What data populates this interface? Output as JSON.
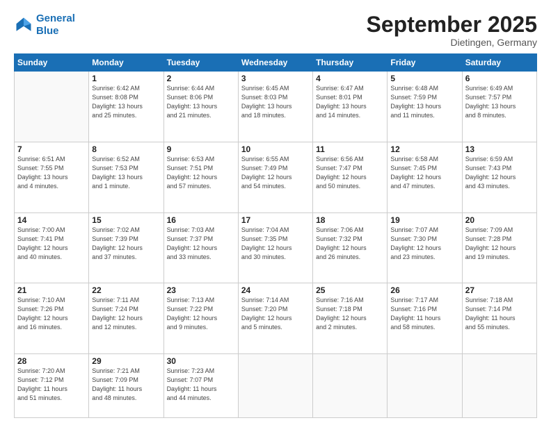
{
  "logo": {
    "line1": "General",
    "line2": "Blue"
  },
  "header": {
    "month": "September 2025",
    "location": "Dietingen, Germany"
  },
  "weekdays": [
    "Sunday",
    "Monday",
    "Tuesday",
    "Wednesday",
    "Thursday",
    "Friday",
    "Saturday"
  ],
  "weeks": [
    [
      {
        "day": "",
        "info": ""
      },
      {
        "day": "1",
        "info": "Sunrise: 6:42 AM\nSunset: 8:08 PM\nDaylight: 13 hours\nand 25 minutes."
      },
      {
        "day": "2",
        "info": "Sunrise: 6:44 AM\nSunset: 8:06 PM\nDaylight: 13 hours\nand 21 minutes."
      },
      {
        "day": "3",
        "info": "Sunrise: 6:45 AM\nSunset: 8:03 PM\nDaylight: 13 hours\nand 18 minutes."
      },
      {
        "day": "4",
        "info": "Sunrise: 6:47 AM\nSunset: 8:01 PM\nDaylight: 13 hours\nand 14 minutes."
      },
      {
        "day": "5",
        "info": "Sunrise: 6:48 AM\nSunset: 7:59 PM\nDaylight: 13 hours\nand 11 minutes."
      },
      {
        "day": "6",
        "info": "Sunrise: 6:49 AM\nSunset: 7:57 PM\nDaylight: 13 hours\nand 8 minutes."
      }
    ],
    [
      {
        "day": "7",
        "info": "Sunrise: 6:51 AM\nSunset: 7:55 PM\nDaylight: 13 hours\nand 4 minutes."
      },
      {
        "day": "8",
        "info": "Sunrise: 6:52 AM\nSunset: 7:53 PM\nDaylight: 13 hours\nand 1 minute."
      },
      {
        "day": "9",
        "info": "Sunrise: 6:53 AM\nSunset: 7:51 PM\nDaylight: 12 hours\nand 57 minutes."
      },
      {
        "day": "10",
        "info": "Sunrise: 6:55 AM\nSunset: 7:49 PM\nDaylight: 12 hours\nand 54 minutes."
      },
      {
        "day": "11",
        "info": "Sunrise: 6:56 AM\nSunset: 7:47 PM\nDaylight: 12 hours\nand 50 minutes."
      },
      {
        "day": "12",
        "info": "Sunrise: 6:58 AM\nSunset: 7:45 PM\nDaylight: 12 hours\nand 47 minutes."
      },
      {
        "day": "13",
        "info": "Sunrise: 6:59 AM\nSunset: 7:43 PM\nDaylight: 12 hours\nand 43 minutes."
      }
    ],
    [
      {
        "day": "14",
        "info": "Sunrise: 7:00 AM\nSunset: 7:41 PM\nDaylight: 12 hours\nand 40 minutes."
      },
      {
        "day": "15",
        "info": "Sunrise: 7:02 AM\nSunset: 7:39 PM\nDaylight: 12 hours\nand 37 minutes."
      },
      {
        "day": "16",
        "info": "Sunrise: 7:03 AM\nSunset: 7:37 PM\nDaylight: 12 hours\nand 33 minutes."
      },
      {
        "day": "17",
        "info": "Sunrise: 7:04 AM\nSunset: 7:35 PM\nDaylight: 12 hours\nand 30 minutes."
      },
      {
        "day": "18",
        "info": "Sunrise: 7:06 AM\nSunset: 7:32 PM\nDaylight: 12 hours\nand 26 minutes."
      },
      {
        "day": "19",
        "info": "Sunrise: 7:07 AM\nSunset: 7:30 PM\nDaylight: 12 hours\nand 23 minutes."
      },
      {
        "day": "20",
        "info": "Sunrise: 7:09 AM\nSunset: 7:28 PM\nDaylight: 12 hours\nand 19 minutes."
      }
    ],
    [
      {
        "day": "21",
        "info": "Sunrise: 7:10 AM\nSunset: 7:26 PM\nDaylight: 12 hours\nand 16 minutes."
      },
      {
        "day": "22",
        "info": "Sunrise: 7:11 AM\nSunset: 7:24 PM\nDaylight: 12 hours\nand 12 minutes."
      },
      {
        "day": "23",
        "info": "Sunrise: 7:13 AM\nSunset: 7:22 PM\nDaylight: 12 hours\nand 9 minutes."
      },
      {
        "day": "24",
        "info": "Sunrise: 7:14 AM\nSunset: 7:20 PM\nDaylight: 12 hours\nand 5 minutes."
      },
      {
        "day": "25",
        "info": "Sunrise: 7:16 AM\nSunset: 7:18 PM\nDaylight: 12 hours\nand 2 minutes."
      },
      {
        "day": "26",
        "info": "Sunrise: 7:17 AM\nSunset: 7:16 PM\nDaylight: 11 hours\nand 58 minutes."
      },
      {
        "day": "27",
        "info": "Sunrise: 7:18 AM\nSunset: 7:14 PM\nDaylight: 11 hours\nand 55 minutes."
      }
    ],
    [
      {
        "day": "28",
        "info": "Sunrise: 7:20 AM\nSunset: 7:12 PM\nDaylight: 11 hours\nand 51 minutes."
      },
      {
        "day": "29",
        "info": "Sunrise: 7:21 AM\nSunset: 7:09 PM\nDaylight: 11 hours\nand 48 minutes."
      },
      {
        "day": "30",
        "info": "Sunrise: 7:23 AM\nSunset: 7:07 PM\nDaylight: 11 hours\nand 44 minutes."
      },
      {
        "day": "",
        "info": ""
      },
      {
        "day": "",
        "info": ""
      },
      {
        "day": "",
        "info": ""
      },
      {
        "day": "",
        "info": ""
      }
    ]
  ]
}
